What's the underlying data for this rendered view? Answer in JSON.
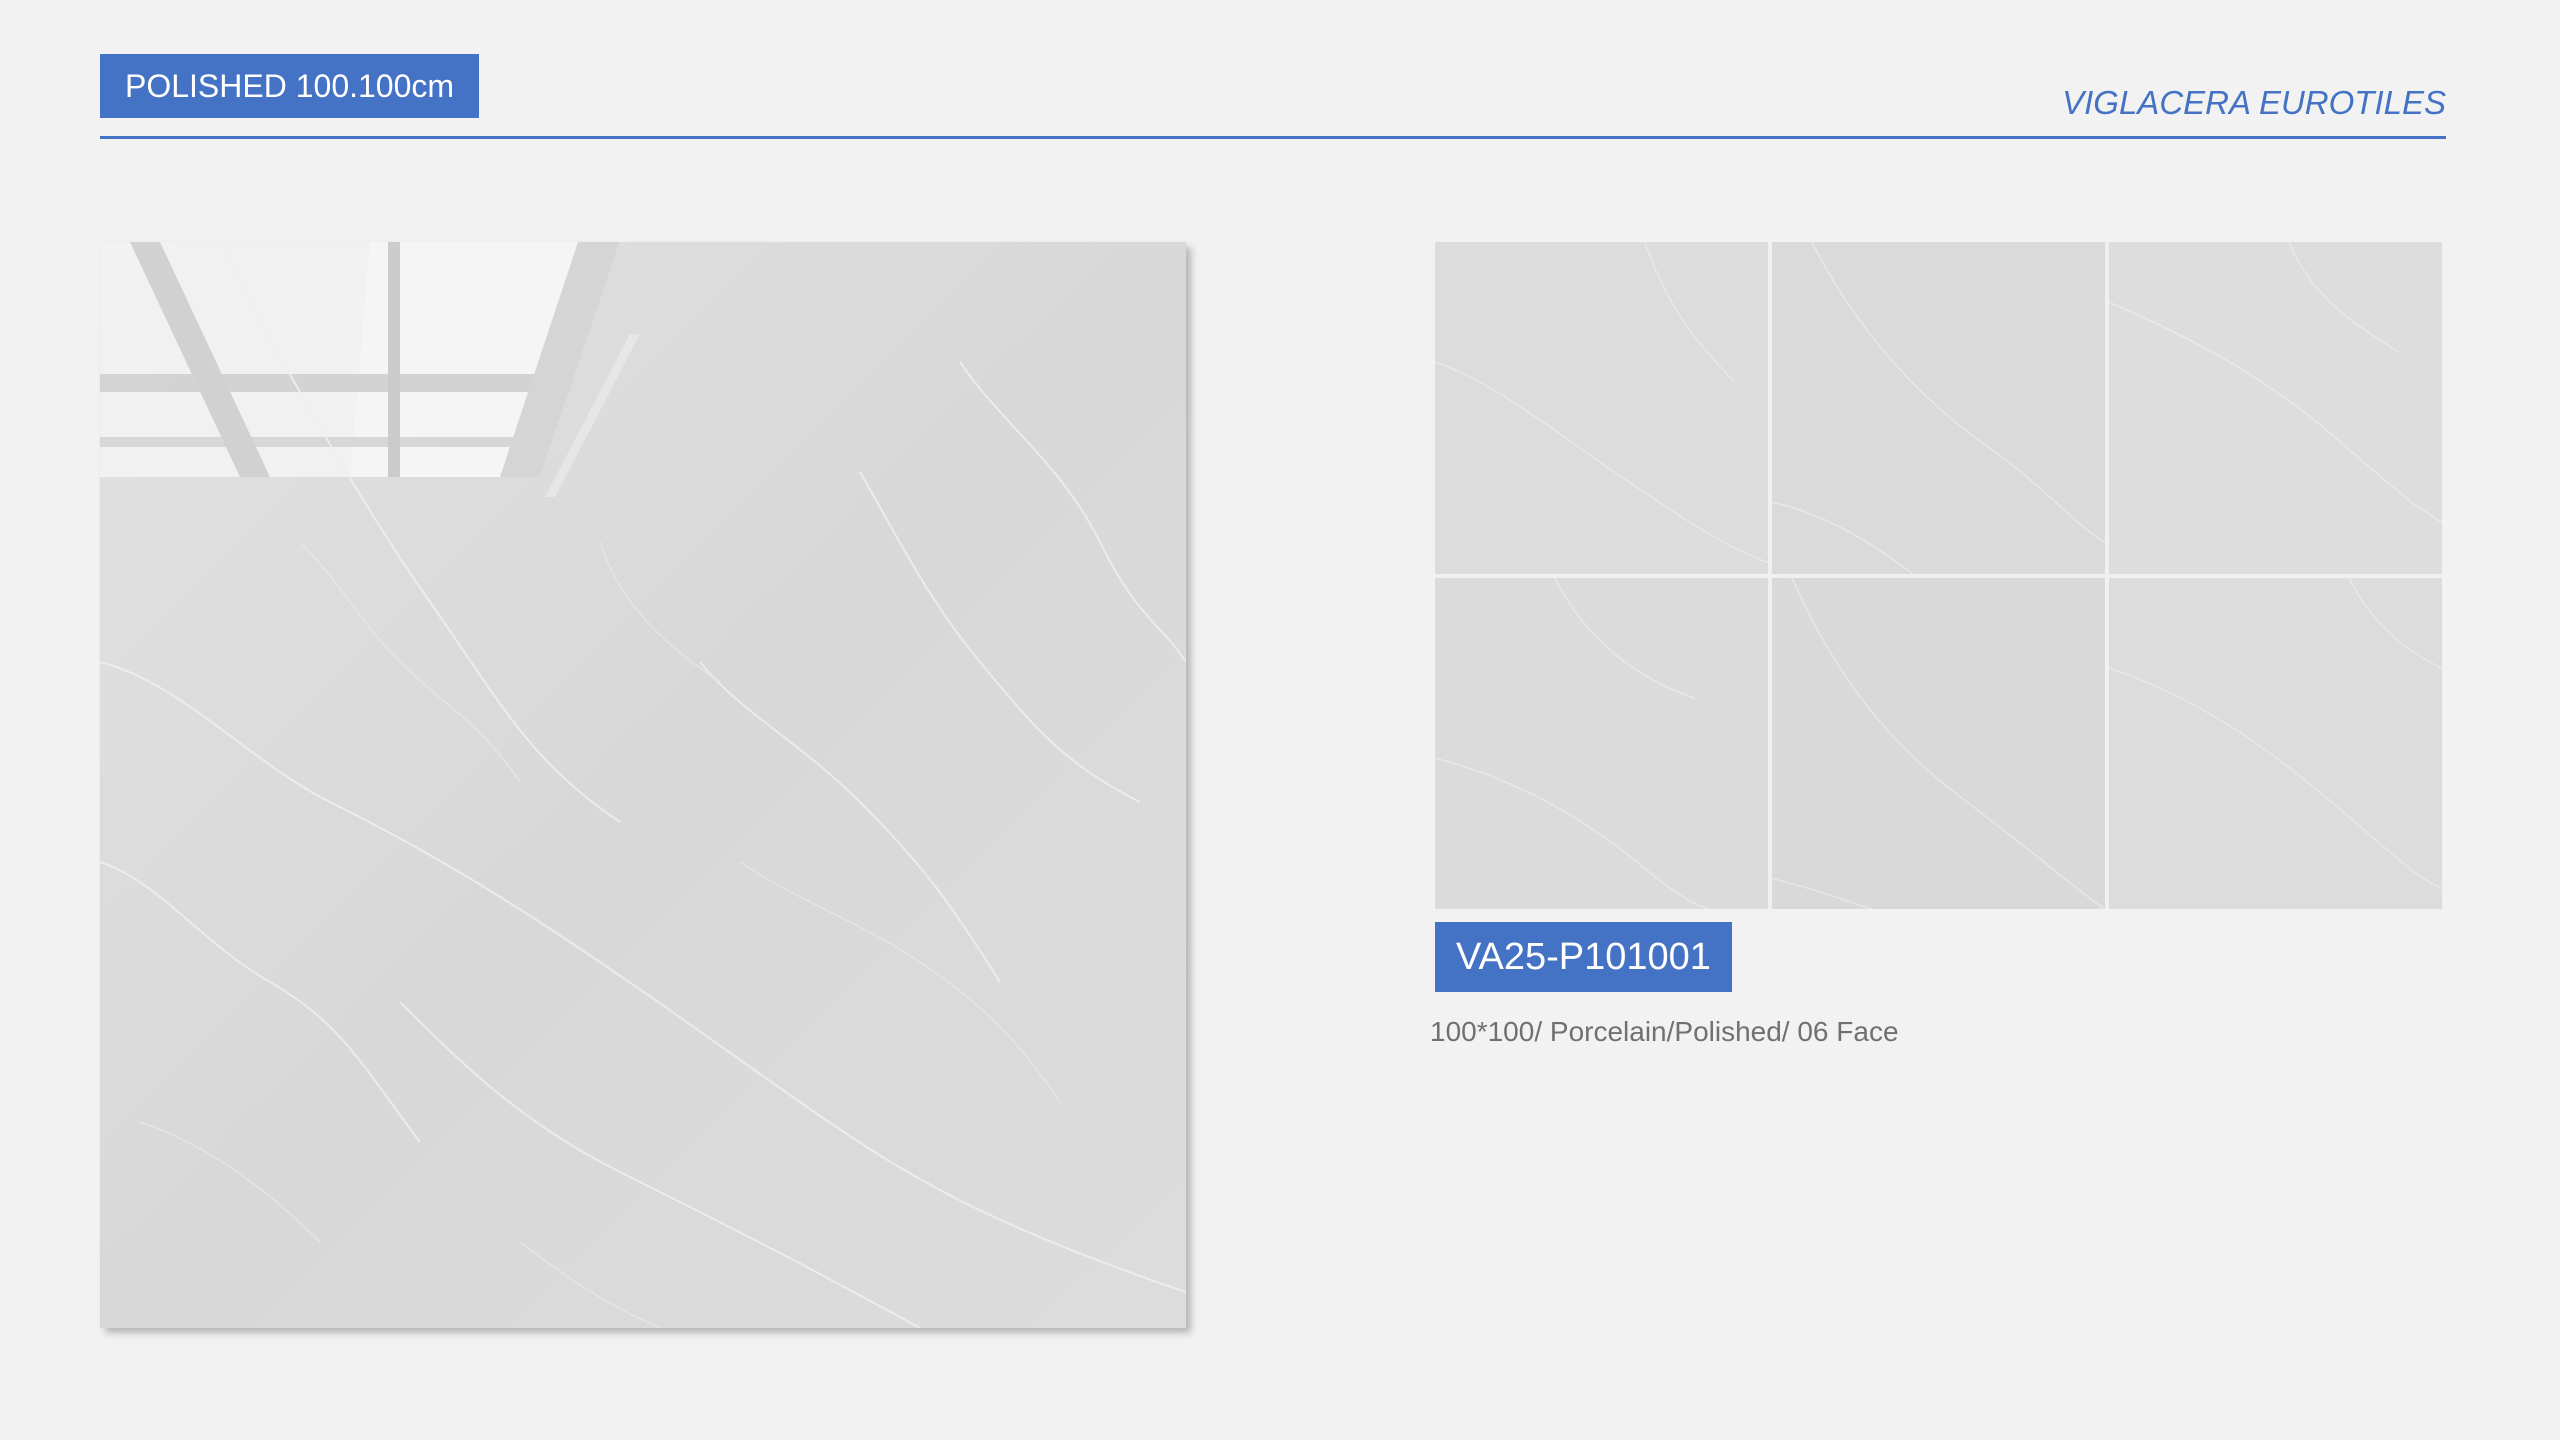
{
  "header": {
    "title": "POLISHED 100.100cm",
    "brand": "VIGLACERA EUROTILES"
  },
  "product": {
    "code": "VA25-P101001",
    "spec": "100*100/ Porcelain/Polished/ 06 Face",
    "grid_faces": 6
  },
  "colors": {
    "accent": "#4472c4",
    "background": "#f2f2f2",
    "tile": "#dadada",
    "spec_text": "#707070"
  }
}
